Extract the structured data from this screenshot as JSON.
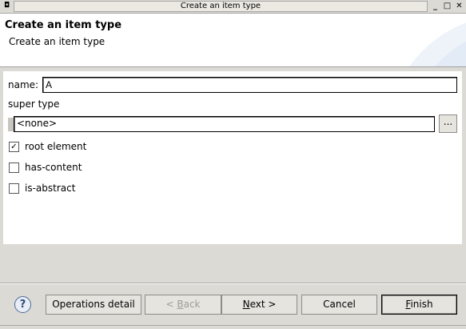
{
  "window": {
    "title": "Create an item type",
    "menu_icon": "window-menu-icon",
    "minimize": "_",
    "maximize": "□",
    "close": "✕"
  },
  "header": {
    "title": "Create an item type",
    "subtitle": "Create an item type"
  },
  "form": {
    "name_label": "name:",
    "name_value": "A",
    "super_type_label": "super type",
    "super_type_value": "<none>",
    "browse_label": "...",
    "checkboxes": [
      {
        "label": "root element",
        "checked": true
      },
      {
        "label": "has-content",
        "checked": false
      },
      {
        "label": "is-abstract",
        "checked": false
      }
    ]
  },
  "footer": {
    "help": "?",
    "operations_detail": "Operations detail",
    "back_prefix": "< ",
    "back_mnemonic": "B",
    "back_rest": "ack",
    "next_mnemonic": "N",
    "next_rest": "ext >",
    "cancel": "Cancel",
    "finish_mnemonic": "F",
    "finish_rest": "inish"
  }
}
